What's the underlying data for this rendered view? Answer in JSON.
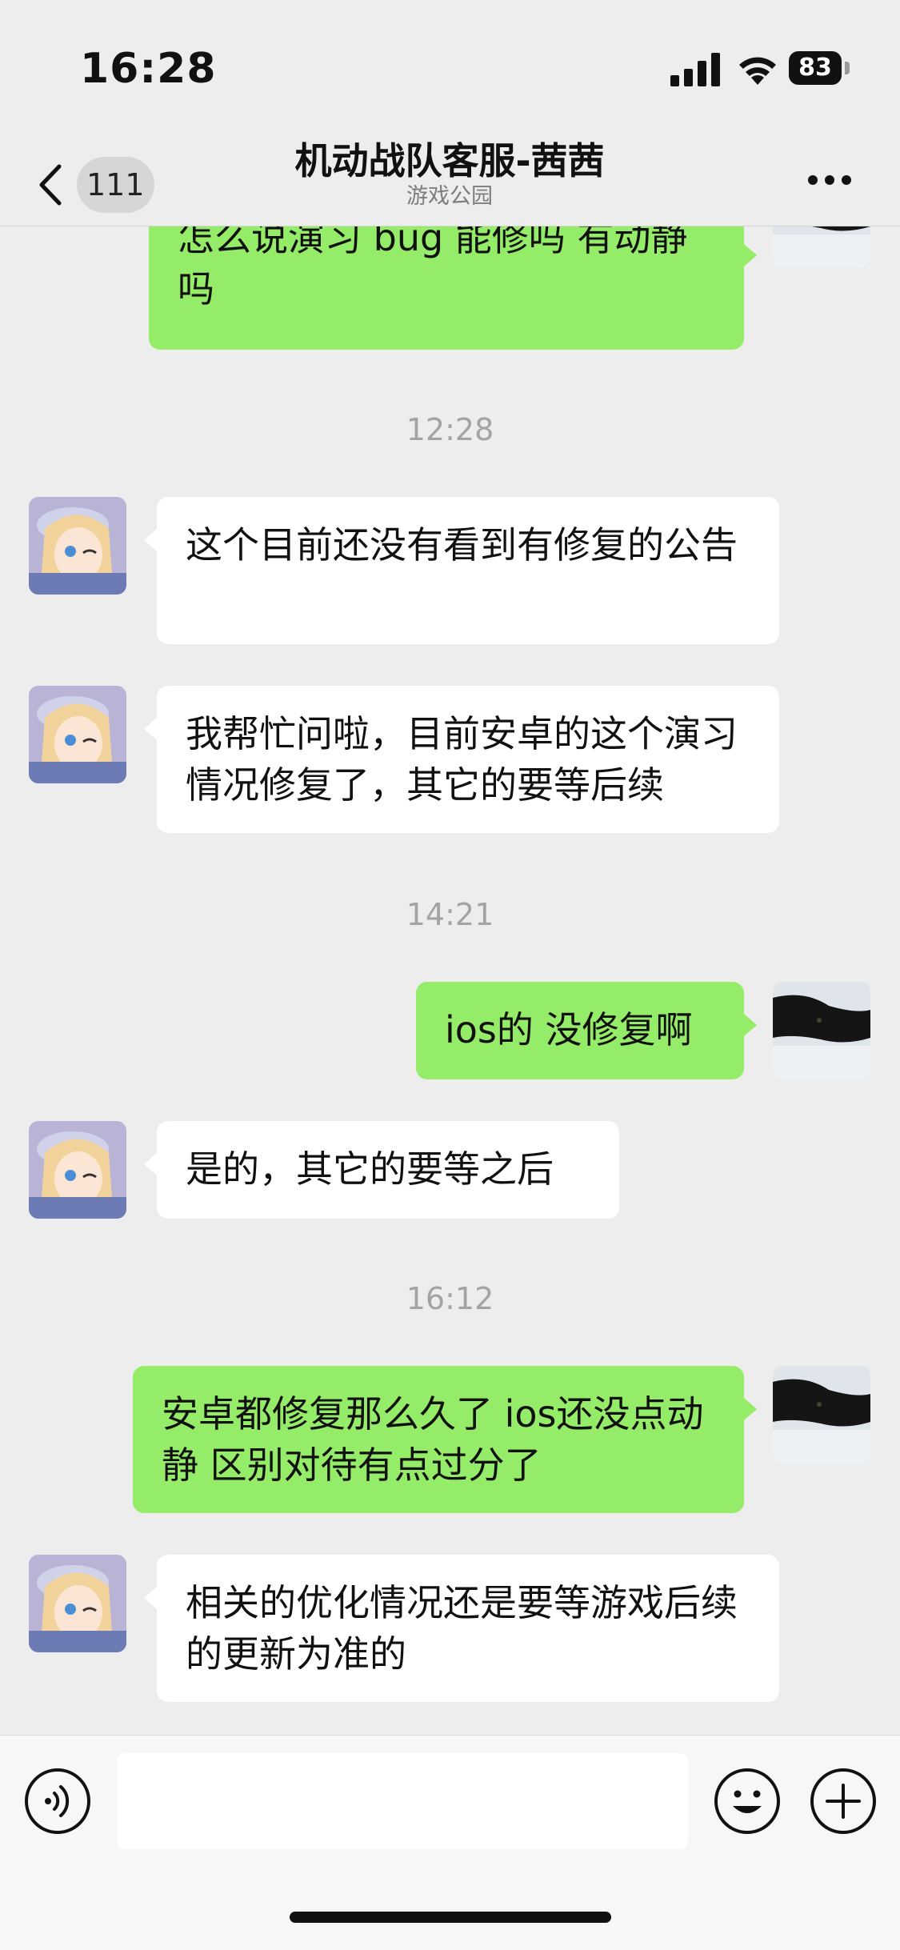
{
  "status_bar": {
    "time": "16:28",
    "battery": "83"
  },
  "header": {
    "unread_count": "111",
    "title": "机动战队客服-茜茜",
    "subtitle": "游戏公园"
  },
  "messages": [
    {
      "side": "out",
      "text": "怎么说演习 bug 能修吗 有动静吗"
    },
    {
      "timestamp": "12:28"
    },
    {
      "side": "in",
      "text": "这个目前还没有看到有修复的公告"
    },
    {
      "side": "in",
      "text": "我帮忙问啦，目前安卓的这个演习情况修复了，其它的要等后续"
    },
    {
      "timestamp": "14:21"
    },
    {
      "side": "out",
      "text": "ios的 没修复啊"
    },
    {
      "side": "in",
      "text": "是的，其它的要等之后"
    },
    {
      "timestamp": "16:12"
    },
    {
      "side": "out",
      "text": "安卓都修复那么久了 ios还没点动静 区别对待有点过分了"
    },
    {
      "side": "in",
      "text": "相关的优化情况还是要等游戏后续的更新为准的"
    }
  ],
  "input": {
    "value": "",
    "placeholder": ""
  },
  "colors": {
    "background": "#ededed",
    "outgoing_bubble": "#95ec69",
    "incoming_bubble": "#ffffff",
    "timestamp_text": "#a3a3a3"
  },
  "icons": {
    "back": "chevron-left-icon",
    "more": "more-dots-icon",
    "voice": "voice-icon",
    "emoji": "emoji-icon",
    "plus": "plus-icon"
  }
}
